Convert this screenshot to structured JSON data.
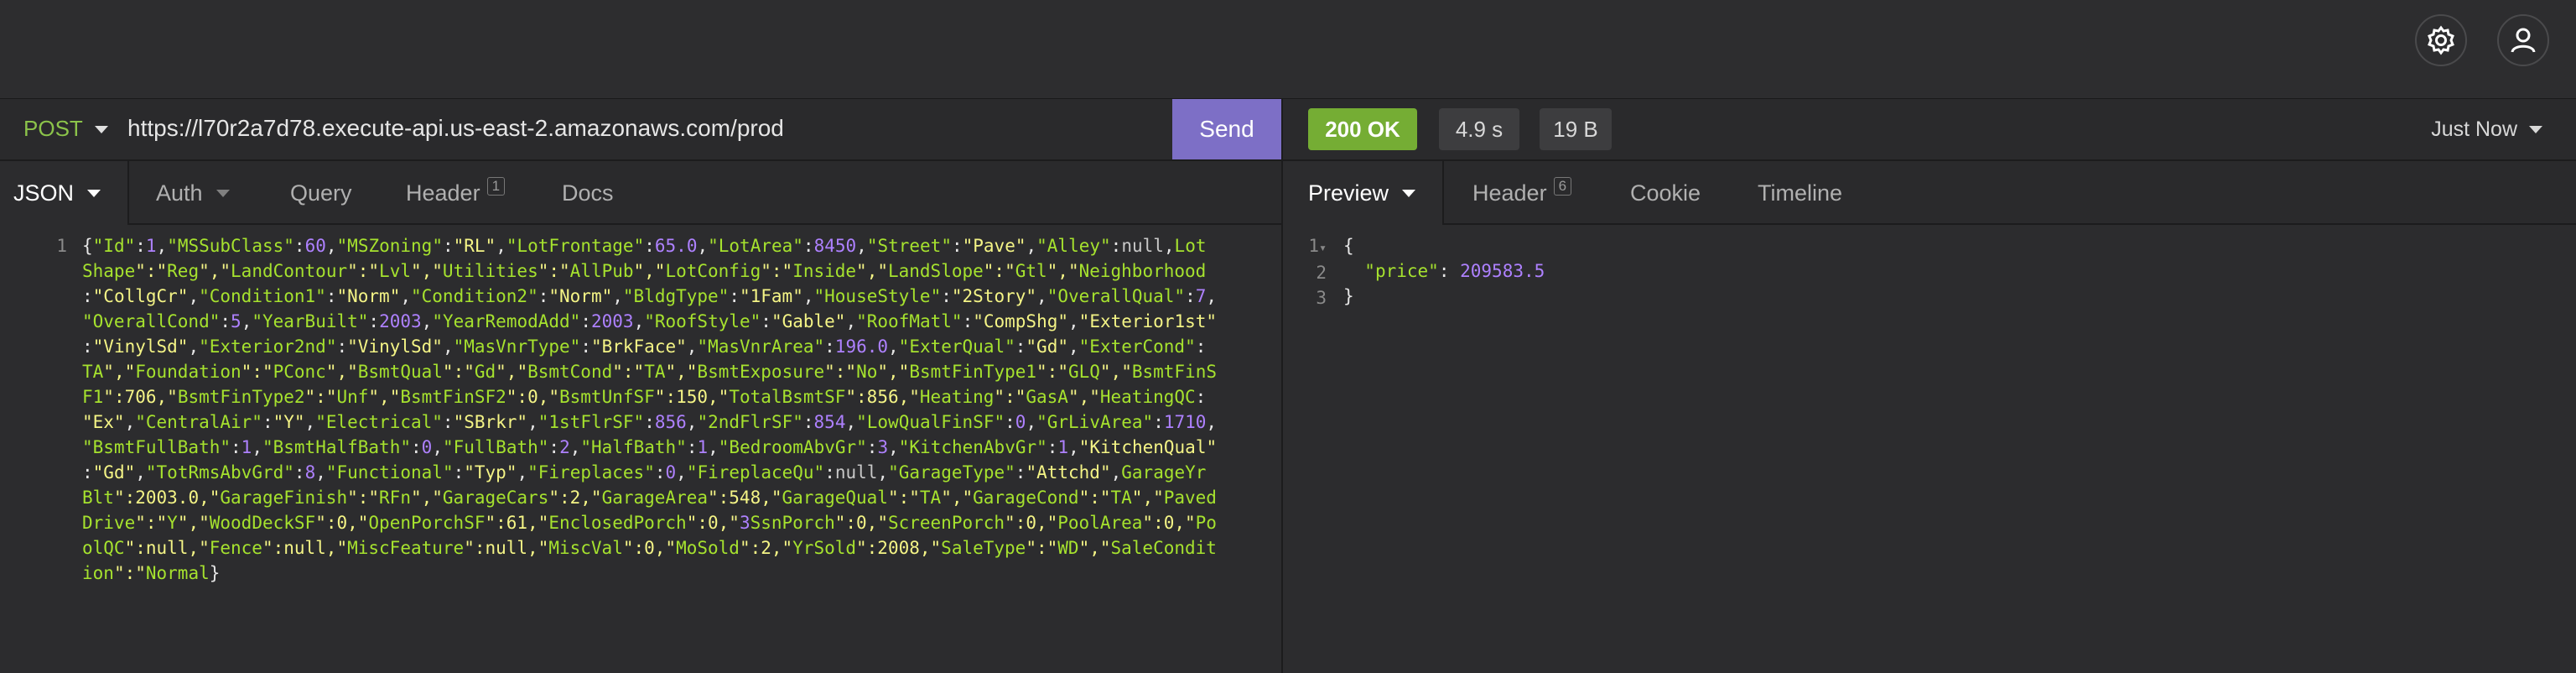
{
  "request": {
    "method": "POST",
    "url": "https://l70r2a7d78.execute-api.us-east-2.amazonaws.com/prod",
    "send_label": "Send"
  },
  "response": {
    "status": "200 OK",
    "time": "4.9 s",
    "size": "19 B",
    "history": "Just Now"
  },
  "request_tabs": [
    {
      "label": "JSON"
    },
    {
      "label": "Auth"
    },
    {
      "label": "Query"
    },
    {
      "label": "Header",
      "count": "1"
    },
    {
      "label": "Docs"
    }
  ],
  "response_tabs": [
    {
      "label": "Preview"
    },
    {
      "label": "Header",
      "count": "6"
    },
    {
      "label": "Cookie"
    },
    {
      "label": "Timeline"
    }
  ],
  "request_body": {
    "line_numbers": [
      "1"
    ],
    "lines": [
      "{\"Id\":1,\"MSSubClass\":60,\"MSZoning\":\"RL\",\"LotFrontage\":65.0,\"LotArea\":8450,\"Street\":\"Pave\",\"Alley\":null,\"Lot",
      "Shape\":\"Reg\",\"LandContour\":\"Lvl\",\"Utilities\":\"AllPub\",\"LotConfig\":\"Inside\",\"LandSlope\":\"Gtl\",\"Neighborhood\"",
      ":\"CollgCr\",\"Condition1\":\"Norm\",\"Condition2\":\"Norm\",\"BldgType\":\"1Fam\",\"HouseStyle\":\"2Story\",\"OverallQual\":7,",
      "\"OverallCond\":5,\"YearBuilt\":2003,\"YearRemodAdd\":2003,\"RoofStyle\":\"Gable\",\"RoofMatl\":\"CompShg\",\"Exterior1st\"",
      ":\"VinylSd\",\"Exterior2nd\":\"VinylSd\",\"MasVnrType\":\"BrkFace\",\"MasVnrArea\":196.0,\"ExterQual\":\"Gd\",\"ExterCond\":\"",
      "TA\",\"Foundation\":\"PConc\",\"BsmtQual\":\"Gd\",\"BsmtCond\":\"TA\",\"BsmtExposure\":\"No\",\"BsmtFinType1\":\"GLQ\",\"BsmtFinS",
      "F1\":706,\"BsmtFinType2\":\"Unf\",\"BsmtFinSF2\":0,\"BsmtUnfSF\":150,\"TotalBsmtSF\":856,\"Heating\":\"GasA\",\"HeatingQC\":",
      "\"Ex\",\"CentralAir\":\"Y\",\"Electrical\":\"SBrkr\",\"1stFlrSF\":856,\"2ndFlrSF\":854,\"LowQualFinSF\":0,\"GrLivArea\":1710,",
      "\"BsmtFullBath\":1,\"BsmtHalfBath\":0,\"FullBath\":2,\"HalfBath\":1,\"BedroomAbvGr\":3,\"KitchenAbvGr\":1,\"KitchenQual\"",
      ":\"Gd\",\"TotRmsAbvGrd\":8,\"Functional\":\"Typ\",\"Fireplaces\":0,\"FireplaceQu\":null,\"GarageType\":\"Attchd\",\"GarageYr",
      "Blt\":2003.0,\"GarageFinish\":\"RFn\",\"GarageCars\":2,\"GarageArea\":548,\"GarageQual\":\"TA\",\"GarageCond\":\"TA\",\"Paved",
      "Drive\":\"Y\",\"WoodDeckSF\":0,\"OpenPorchSF\":61,\"EnclosedPorch\":0,\"3SsnPorch\":0,\"ScreenPorch\":0,\"PoolArea\":0,\"Po",
      "olQC\":null,\"Fence\":null,\"MiscFeature\":null,\"MiscVal\":0,\"MoSold\":2,\"YrSold\":2008,\"SaleType\":\"WD\",\"SaleCondit",
      "ion\":\"Normal\"}"
    ]
  },
  "response_body": {
    "line_numbers": [
      "1",
      "2",
      "3"
    ],
    "lines": [
      "{",
      "  \"price\": 209583.5",
      "}"
    ]
  },
  "icons": {
    "settings": "gear-icon",
    "account": "user-icon"
  }
}
